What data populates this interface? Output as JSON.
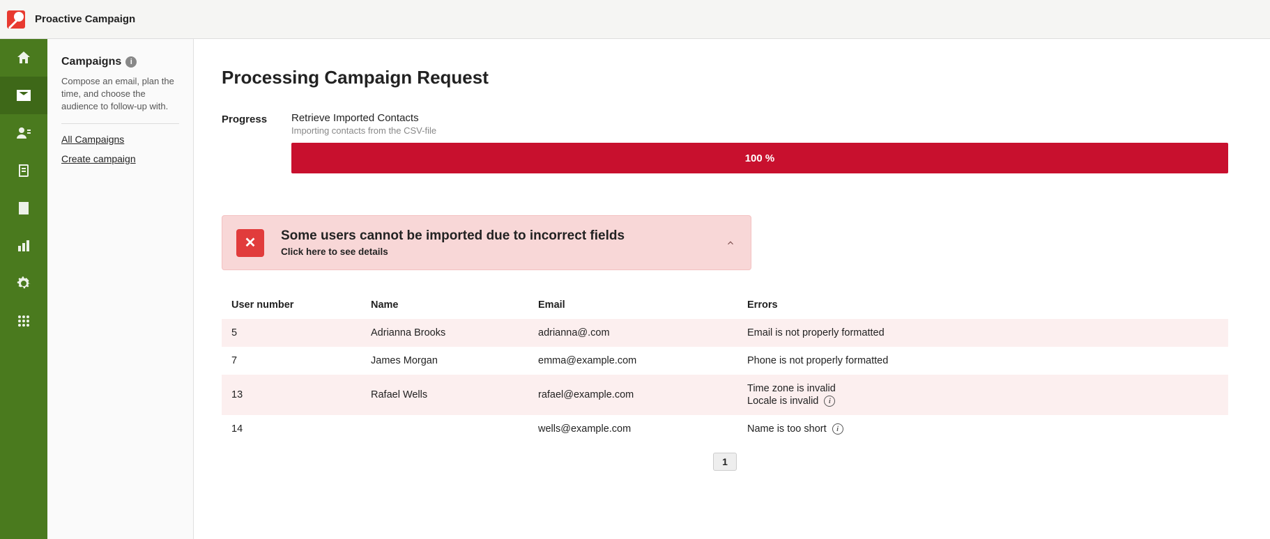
{
  "header": {
    "title": "Proactive Campaign"
  },
  "sidebar": {
    "heading": "Campaigns",
    "description": "Compose an email, plan the time, and choose the audience to follow-up with.",
    "links": {
      "all": "All Campaigns",
      "create": "Create campaign"
    }
  },
  "main": {
    "page_title": "Processing Campaign Request",
    "progress": {
      "label": "Progress",
      "step_title": "Retrieve Imported Contacts",
      "step_subtitle": "Importing contacts from the CSV-file",
      "percent_text": "100 %"
    },
    "alert": {
      "title": "Some users cannot be imported due to incorrect fields",
      "subtitle": "Click here to see details"
    },
    "table": {
      "headers": {
        "user_number": "User number",
        "name": "Name",
        "email": "Email",
        "errors": "Errors"
      },
      "rows": [
        {
          "num": "5",
          "name": "Adrianna Brooks",
          "email": "adrianna@.com",
          "errors": [
            "Email is not properly formatted"
          ],
          "info": false
        },
        {
          "num": "7",
          "name": "James Morgan",
          "email": "emma@example.com",
          "errors": [
            "Phone is not properly formatted"
          ],
          "info": false
        },
        {
          "num": "13",
          "name": "Rafael Wells",
          "email": "rafael@example.com",
          "errors": [
            "Time zone is invalid",
            "Locale is invalid"
          ],
          "info": true
        },
        {
          "num": "14",
          "name": "",
          "email": "wells@example.com",
          "errors": [
            "Name is too short"
          ],
          "info": true
        }
      ]
    },
    "pagination": {
      "current": "1"
    }
  }
}
